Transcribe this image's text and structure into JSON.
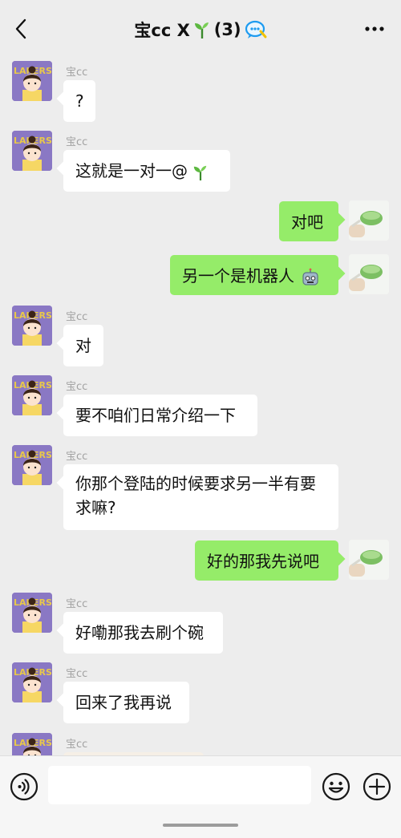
{
  "header": {
    "title_prefix": "宝cc X ",
    "title_count": "(3)",
    "back_icon": "chevron-left-icon",
    "more_icon": "more-dots-icon"
  },
  "messages": [
    {
      "side": "left",
      "sender": "宝cc",
      "text": "?"
    },
    {
      "side": "left",
      "sender": "宝cc",
      "text": "这就是一对一@"
    },
    {
      "side": "right",
      "text": "对吧"
    },
    {
      "side": "right",
      "text": "另一个是机器人"
    },
    {
      "side": "left",
      "sender": "宝cc",
      "text": "对"
    },
    {
      "side": "left",
      "sender": "宝cc",
      "text": "要不咱们日常介绍一下"
    },
    {
      "side": "left",
      "sender": "宝cc",
      "text_line1": "你那个登陆的时候要求另一半有要",
      "text_line2": "求嘛?"
    },
    {
      "side": "right",
      "text": "好的那我先说吧"
    },
    {
      "side": "left",
      "sender": "宝cc",
      "text": "好嘞那我去刷个碗"
    },
    {
      "side": "left",
      "sender": "宝cc",
      "text": "回来了我再说"
    },
    {
      "side": "left",
      "sender": "宝cc",
      "text": ""
    }
  ],
  "input_bar": {
    "placeholder": "",
    "voice_icon": "voice-icon",
    "emoji_icon": "emoji-icon",
    "plus_icon": "plus-icon"
  },
  "colors": {
    "background": "#ededed",
    "bubble_self": "#95ec69",
    "bubble_other": "#ffffff",
    "sender_name": "#a2a2a2"
  }
}
